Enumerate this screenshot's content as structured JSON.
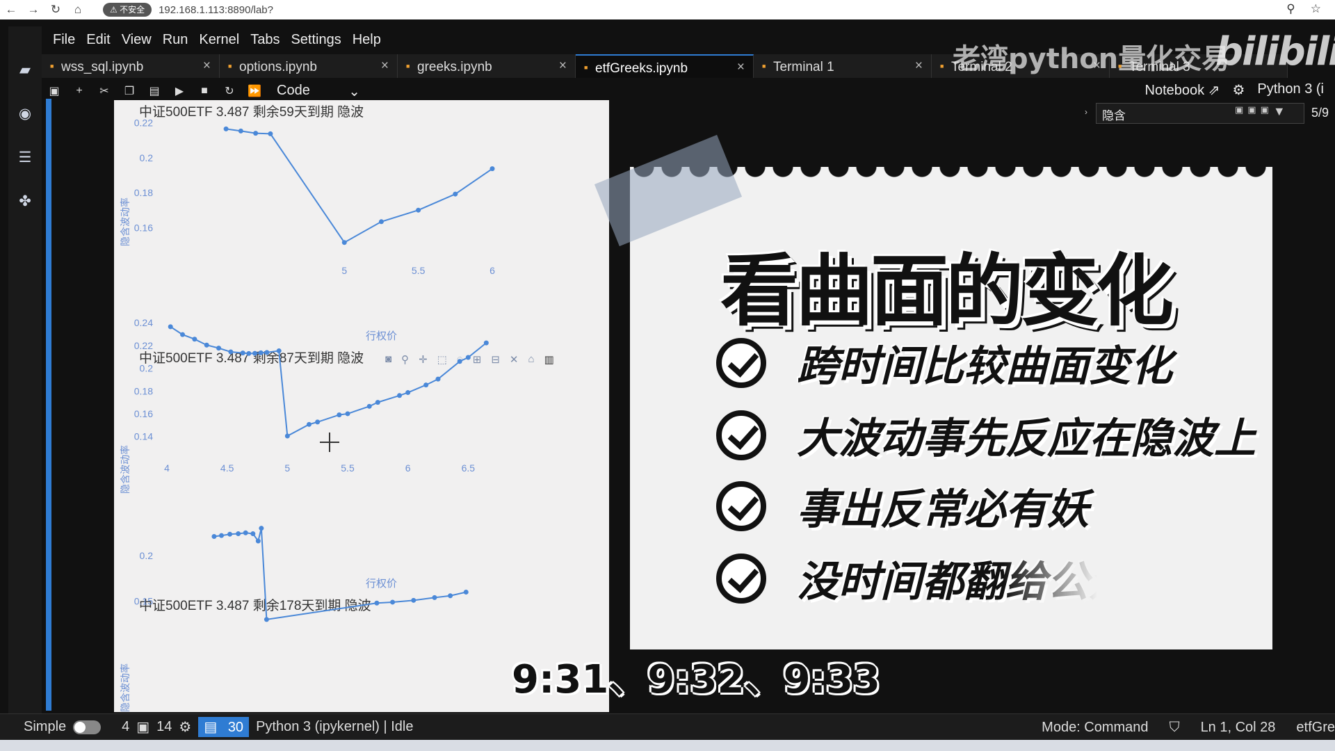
{
  "browser": {
    "nav_icons": [
      "back-icon",
      "forward-icon",
      "reload-icon",
      "home-icon"
    ],
    "security_label": "⚠ 不安全",
    "url": "192.168.1.113:8890/lab?"
  },
  "menu": [
    "File",
    "Edit",
    "View",
    "Run",
    "Kernel",
    "Tabs",
    "Settings",
    "Help"
  ],
  "tabs": [
    {
      "label": "wss_sql.ipynb",
      "active": false
    },
    {
      "label": "options.ipynb",
      "active": false
    },
    {
      "label": "greeks.ipynb",
      "active": false
    },
    {
      "label": "etfGreeks.ipynb",
      "active": true
    },
    {
      "label": "Terminal 1",
      "active": false
    },
    {
      "label": "Terminal 2",
      "active": false
    },
    {
      "label": "Terminal 3",
      "active": false
    }
  ],
  "toolbar": {
    "cell_type": "Code",
    "notebook_link": "Notebook",
    "kernel": "Python 3 (i"
  },
  "find": {
    "query": "隐含",
    "count": "5/9"
  },
  "watermark": {
    "text": "老湾python量化交易",
    "logo": "bilibili"
  },
  "chart_data": [
    {
      "type": "line",
      "title": "中证500ETF 3.487 剩余59天到期 隐波",
      "xlabel": "行权价",
      "ylabel": "隐含波动率",
      "x": [
        4.2,
        4.3,
        4.4,
        4.5,
        5.0,
        5.25,
        5.5,
        5.75,
        6.0
      ],
      "y": [
        0.2165,
        0.2153,
        0.214,
        0.2137,
        0.1515,
        0.1634,
        0.17,
        0.1792,
        0.1937
      ],
      "xticks": [
        5,
        5.5,
        6
      ],
      "yticks": [
        0.16,
        0.18,
        0.2,
        0.22
      ],
      "xlim": [
        3.8,
        6.0
      ],
      "ylim": [
        0.147,
        0.225
      ],
      "color": "#4a88d8"
    },
    {
      "type": "line",
      "title": "中证500ETF 3.487 剩余87天到期 隐波",
      "xlabel": "行权价",
      "ylabel": "隐含波动率",
      "x": [
        4.03,
        4.13,
        4.23,
        4.33,
        4.43,
        4.53,
        4.63,
        4.68,
        4.73,
        4.78,
        4.83,
        4.93,
        5.0,
        5.18,
        5.25,
        5.43,
        5.5,
        5.68,
        5.75,
        5.93,
        6.0,
        6.15,
        6.25,
        6.43,
        6.5,
        6.65
      ],
      "y": [
        0.2365,
        0.2296,
        0.2256,
        0.2204,
        0.2177,
        0.2144,
        0.2134,
        0.213,
        0.2131,
        0.2136,
        0.2139,
        0.2153,
        0.1404,
        0.1506,
        0.1527,
        0.159,
        0.16,
        0.1665,
        0.17,
        0.176,
        0.1786,
        0.1853,
        0.1905,
        0.206,
        0.2095,
        0.2223
      ],
      "xticks": [
        4,
        4.5,
        5,
        5.5,
        6,
        6.5
      ],
      "yticks": [
        0.14,
        0.16,
        0.18,
        0.2,
        0.22,
        0.24
      ],
      "xlim": [
        4.0,
        6.7
      ],
      "ylim": [
        0.13,
        0.245
      ],
      "color": "#4a88d8"
    },
    {
      "type": "line",
      "title": "中证500ETF 3.487 剩余178天到期 隐波",
      "xlabel": "",
      "ylabel": "隐含波动率",
      "x": [
        4.05,
        4.12,
        4.2,
        4.28,
        4.35,
        4.42,
        4.47,
        4.5,
        4.55,
        5.6,
        5.75,
        5.95,
        6.15,
        6.3,
        6.45
      ],
      "y": [
        0.221,
        0.222,
        0.2235,
        0.224,
        0.225,
        0.224,
        0.216,
        0.23,
        0.13,
        0.148,
        0.149,
        0.151,
        0.154,
        0.156,
        0.16
      ],
      "xticks": [],
      "yticks": [
        0.2,
        0.15
      ],
      "xlim": [
        3.6,
        6.7
      ],
      "ylim": [
        0.12,
        0.245
      ],
      "color": "#4a88d8"
    }
  ],
  "slide": {
    "headline": "看曲面的变化",
    "items": [
      "跨时间比较曲面变化",
      "大波动事先反应在隐波上",
      "事出反常必有妖",
      "没时间都翻给公众号"
    ]
  },
  "caption": "9:31、9:32、9:33",
  "status": {
    "mode_toggle": "Simple",
    "num1": "4",
    "num2": "14",
    "badge": "30",
    "kernel_status": "Python 3 (ipykernel) | Idle",
    "mode": "Mode: Command",
    "cursor": "Ln 1, Col 28",
    "file": "etfGre"
  }
}
